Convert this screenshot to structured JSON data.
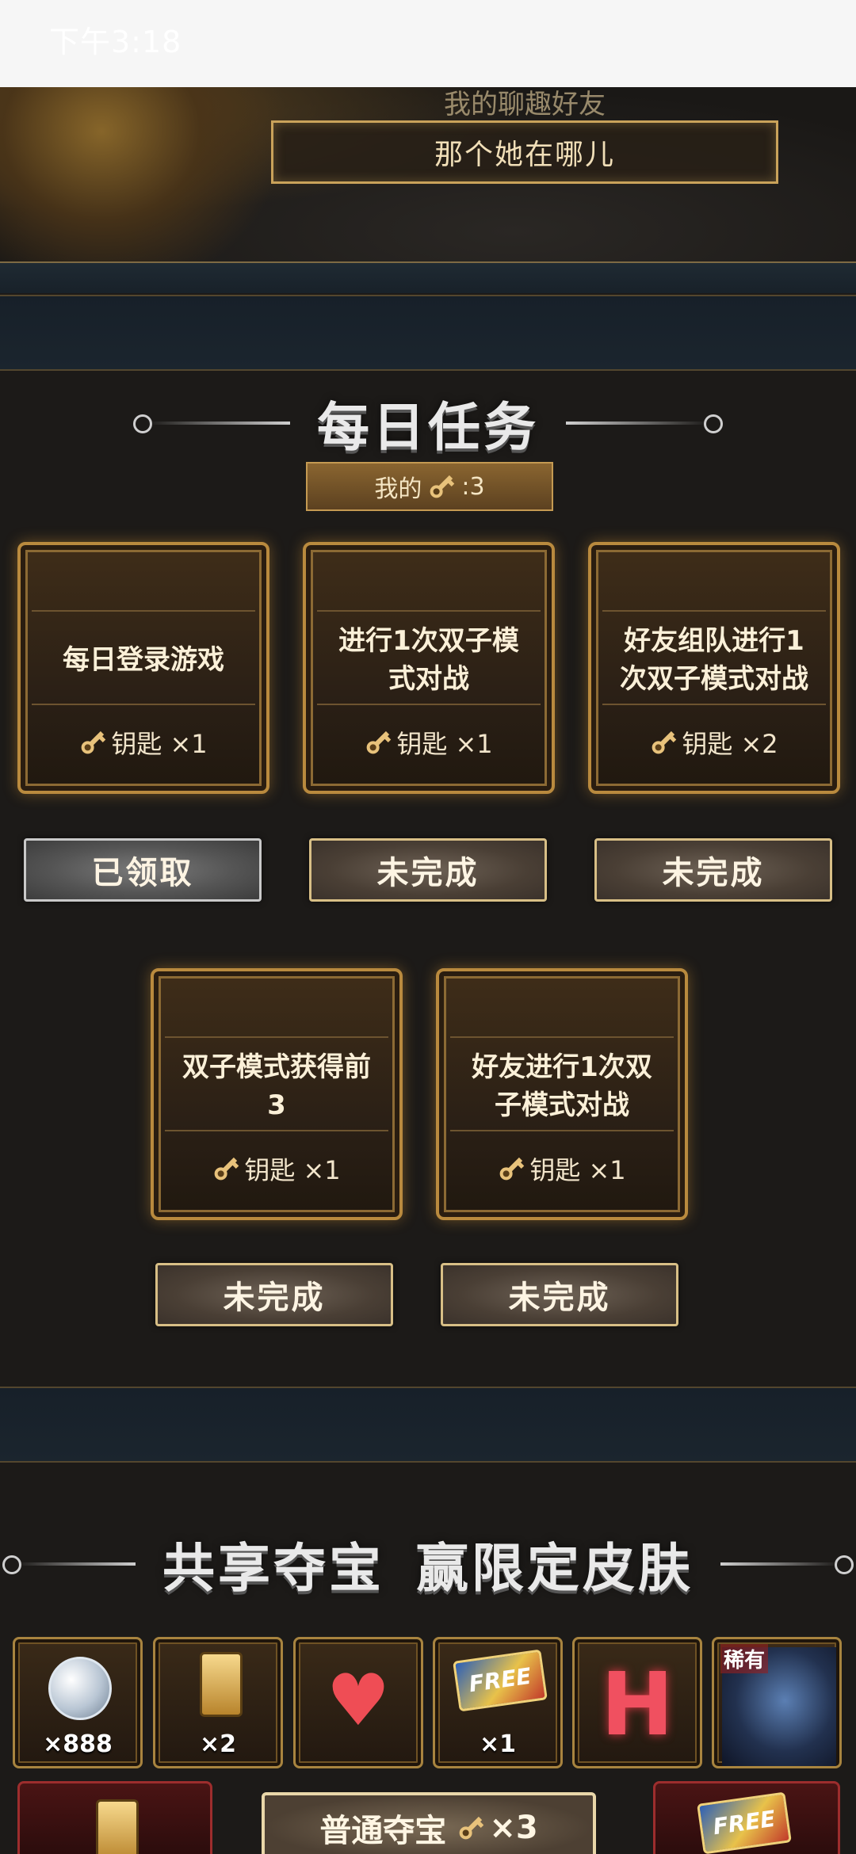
{
  "status_bar": {
    "time": "下午3:18"
  },
  "hero": {
    "subtitle": "我的聊趣好友",
    "link_text": "那个她在哪儿"
  },
  "daily": {
    "title": "每日任务",
    "my_keys_label": "我的",
    "my_keys_count": ":3",
    "tasks": [
      {
        "text": "每日登录游戏",
        "reward": "钥匙 ×1",
        "button": "已领取",
        "status": "claimed"
      },
      {
        "text": "进行1次双子模式对战",
        "reward": "钥匙 ×1",
        "button": "未完成",
        "status": "incomplete"
      },
      {
        "text": "好友组队进行1次双子模式对战",
        "reward": "钥匙 ×2",
        "button": "未完成",
        "status": "incomplete"
      },
      {
        "text": "双子模式获得前3",
        "reward": "钥匙 ×1",
        "button": "未完成",
        "status": "incomplete"
      },
      {
        "text": "好友进行1次双子模式对战",
        "reward": "钥匙 ×1",
        "button": "未完成",
        "status": "incomplete"
      }
    ]
  },
  "treasure": {
    "title_left": "共享夺宝",
    "title_right": "赢限定皮肤",
    "prizes": [
      {
        "icon": "silver-coin-icon",
        "count": "×888"
      },
      {
        "icon": "gold-card-icon",
        "count": "×2"
      },
      {
        "icon": "heart-icon",
        "count": ""
      },
      {
        "icon": "free-ticket-icon",
        "label": "FREE",
        "count": "×1"
      },
      {
        "icon": "letter-h-icon",
        "label": "H",
        "count": ""
      },
      {
        "icon": "skin-portrait-icon",
        "badge": "稀有",
        "count": ""
      }
    ],
    "normal_button": "普通夺宝",
    "normal_cost": "×3",
    "free_label": "FREE"
  }
}
